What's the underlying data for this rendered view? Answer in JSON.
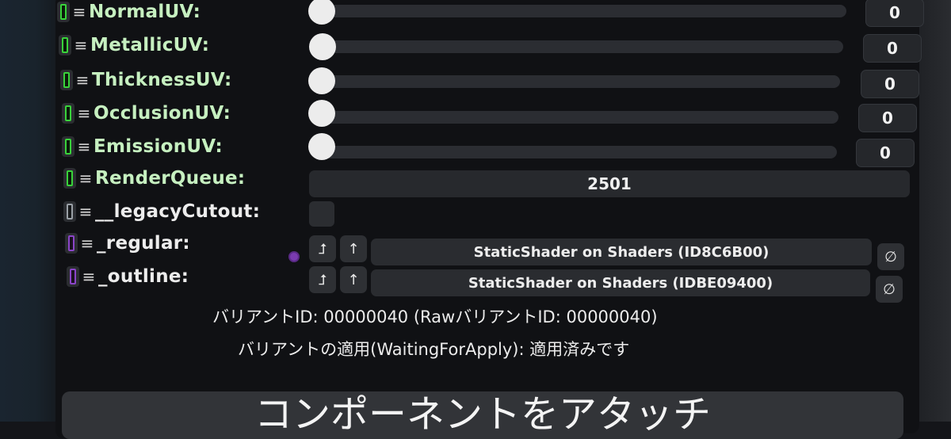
{
  "uv_rows": [
    {
      "label": "NormalUV:",
      "value": "0"
    },
    {
      "label": "MetallicUV:",
      "value": "0"
    },
    {
      "label": "ThicknessUV:",
      "value": "0"
    },
    {
      "label": "OcclusionUV:",
      "value": "0"
    },
    {
      "label": "EmissionUV:",
      "value": "0"
    }
  ],
  "render_queue": {
    "label": "RenderQueue:",
    "value": "2501"
  },
  "legacy_cutout": {
    "label": "__legacyCutout:"
  },
  "regular": {
    "label": "_regular:",
    "object": "StaticShader on Shaders (ID8C6B00)",
    "up_alt": "⮥",
    "up": "↑",
    "clear": "∅"
  },
  "outline": {
    "label": "_outline:",
    "object": "StaticShader on Shaders (IDBE09400)",
    "up_alt": "⮥",
    "up": "↑",
    "clear": "∅"
  },
  "variant_id_text": "バリアントID: 00000040 (RawバリアントID: 00000040)",
  "variant_apply_text": "バリアントの適用(WaitingForApply): 適用済みです",
  "attach_button": "コンポーネントをアタッチ",
  "menu_glyph": "≡",
  "colors": {
    "label_green": "#c6f0c0",
    "pin_green": "#39d33b",
    "pin_purple": "#8b45c9",
    "panel": "#101114"
  }
}
